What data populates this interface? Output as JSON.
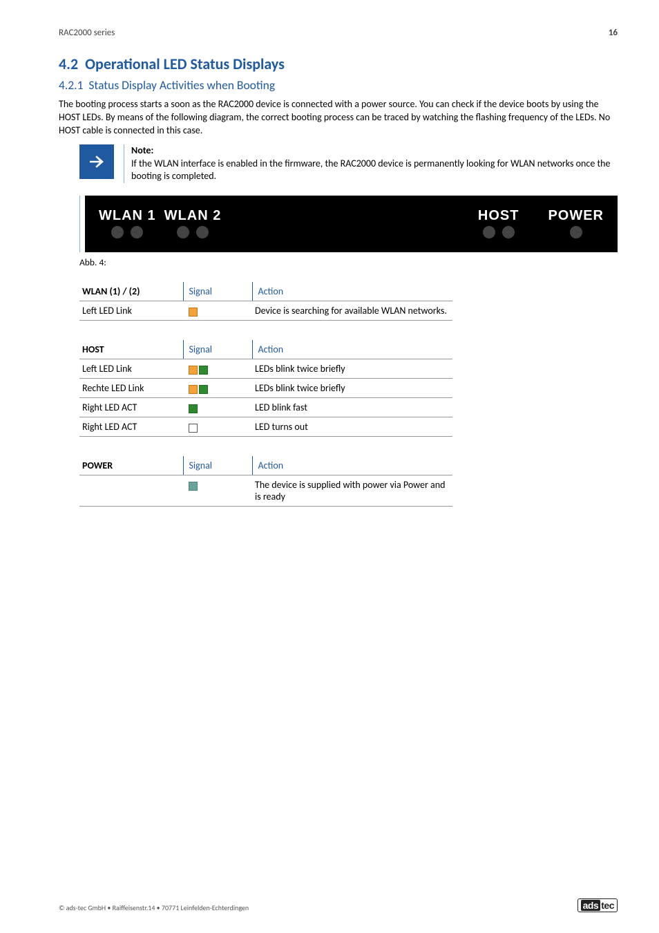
{
  "header": {
    "series": "RAC2000 series",
    "page": "16"
  },
  "section": {
    "num": "4.2",
    "title": "Operational LED Status Displays"
  },
  "subsection": {
    "num": "4.2.1",
    "title": "Status Display Activities when Booting"
  },
  "intro": "The booting process starts a soon as the RAC2000 device is connected with a power source. You can check if the device boots by using the HOST LEDs. By means of the following diagram, the correct booting process can be traced by watching the flashing frequency of the LEDs. No HOST cable is connected in this case.",
  "note": {
    "title": "Note:",
    "body": "If the WLAN interface is enabled in the firmware, the RAC2000 device is permanently looking for WLAN networks once the booting is completed."
  },
  "led_strip": {
    "labels": [
      "WLAN 1",
      "WLAN 2",
      "HOST",
      "POWER"
    ]
  },
  "fig_caption": "Abb. 4:",
  "tables": {
    "wlan": {
      "name": "WLAN (1) / (2)",
      "signal_hdr": "Signal",
      "action_hdr": "Action",
      "rows": [
        {
          "name": "Left LED Link",
          "signal": "orange",
          "action": "Device is searching for available WLAN networks."
        }
      ]
    },
    "host": {
      "name": "HOST",
      "signal_hdr": "Signal",
      "action_hdr": "Action",
      "rows": [
        {
          "name": "Left LED Link",
          "signal": "orange-green",
          "action": "LEDs blink twice briefly"
        },
        {
          "name": "Rechte LED Link",
          "signal": "orange-green",
          "action": "LEDs blink twice briefly"
        },
        {
          "name": "Right LED ACT",
          "signal": "green",
          "action": "LED blink fast"
        },
        {
          "name": "Right LED ACT",
          "signal": "empty",
          "action": "LED turns out"
        }
      ]
    },
    "power": {
      "name": "POWER",
      "signal_hdr": "Signal",
      "action_hdr": "Action",
      "rows": [
        {
          "name": "",
          "signal": "teal",
          "action": "The device is supplied with power via Power and is ready"
        }
      ]
    }
  },
  "footer": {
    "copyright": "© ads-tec GmbH • Raiffeisenstr.14 • 70771 Leinfelden-Echterdingen",
    "logo_ads": "ads",
    "logo_tec": "tec"
  }
}
